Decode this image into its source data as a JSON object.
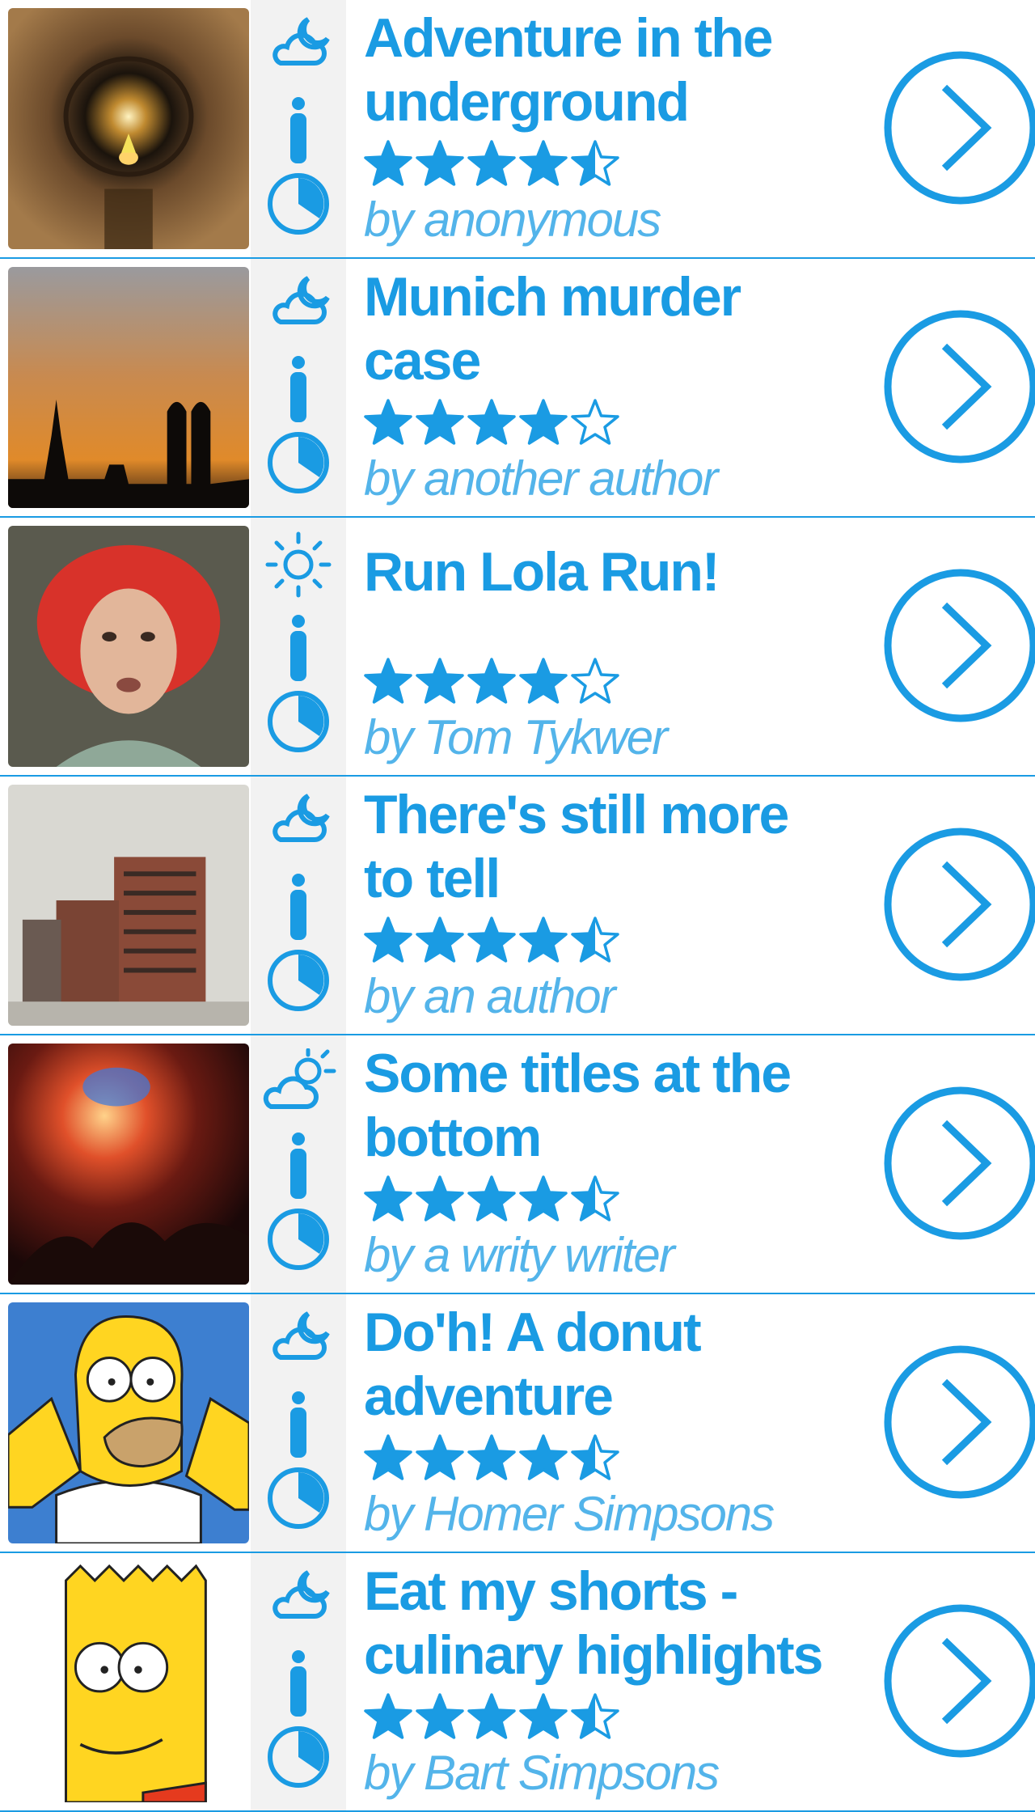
{
  "colors": {
    "accent": "#1a9be3",
    "metaBackground": "#f2f2f2",
    "divider": "#1a9be3"
  },
  "stories": [
    {
      "title": "Adventure in the underground",
      "rating": 4.5,
      "author": "by anonymous",
      "weather_icon": "cloud-moon-icon",
      "thumb": "tunnel"
    },
    {
      "title": "Munich murder case",
      "rating": 4,
      "author": "by another author",
      "weather_icon": "cloud-moon-icon",
      "thumb": "munich-skyline"
    },
    {
      "title": "Run Lola Run!",
      "rating": 4,
      "author": "by Tom Tykwer",
      "weather_icon": "sun-icon",
      "thumb": "red-haired-woman"
    },
    {
      "title": "There's still more to tell",
      "rating": 4.5,
      "author": "by an author",
      "weather_icon": "cloud-moon-icon",
      "thumb": "winter-building"
    },
    {
      "title": "Some titles at the bottom",
      "rating": 4.5,
      "author": "by a writy writer",
      "weather_icon": "cloud-sun-icon",
      "thumb": "concert"
    },
    {
      "title": "Do'h! A donut adventure",
      "rating": 4.5,
      "author": "by Homer Simpsons",
      "weather_icon": "cloud-moon-icon",
      "thumb": "homer"
    },
    {
      "title": "Eat my shorts - culinary highlights",
      "rating": 4.5,
      "author": "by Bart Simpsons",
      "weather_icon": "cloud-moon-icon",
      "thumb": "bart"
    }
  ]
}
